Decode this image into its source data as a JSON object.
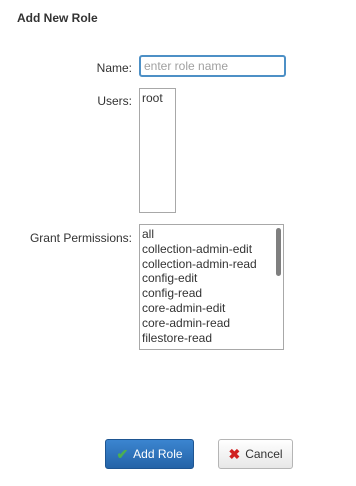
{
  "dialog": {
    "title": "Add New Role"
  },
  "form": {
    "name_label": "Name:",
    "name_value": "",
    "name_placeholder": "enter role name",
    "users_label": "Users:",
    "users": [
      "root"
    ],
    "permissions_label": "Grant Permissions:",
    "permissions": [
      "all",
      "collection-admin-edit",
      "collection-admin-read",
      "config-edit",
      "config-read",
      "core-admin-edit",
      "core-admin-read",
      "filestore-read"
    ]
  },
  "buttons": {
    "add_label": "Add Role",
    "cancel_label": "Cancel"
  },
  "icons": {
    "add": "check-icon",
    "cancel": "close-icon"
  },
  "colors": {
    "primary_button": "#2f75bf",
    "focus_border": "#4d90c6",
    "check": "#4caf50",
    "cancel_x": "#d02020"
  }
}
